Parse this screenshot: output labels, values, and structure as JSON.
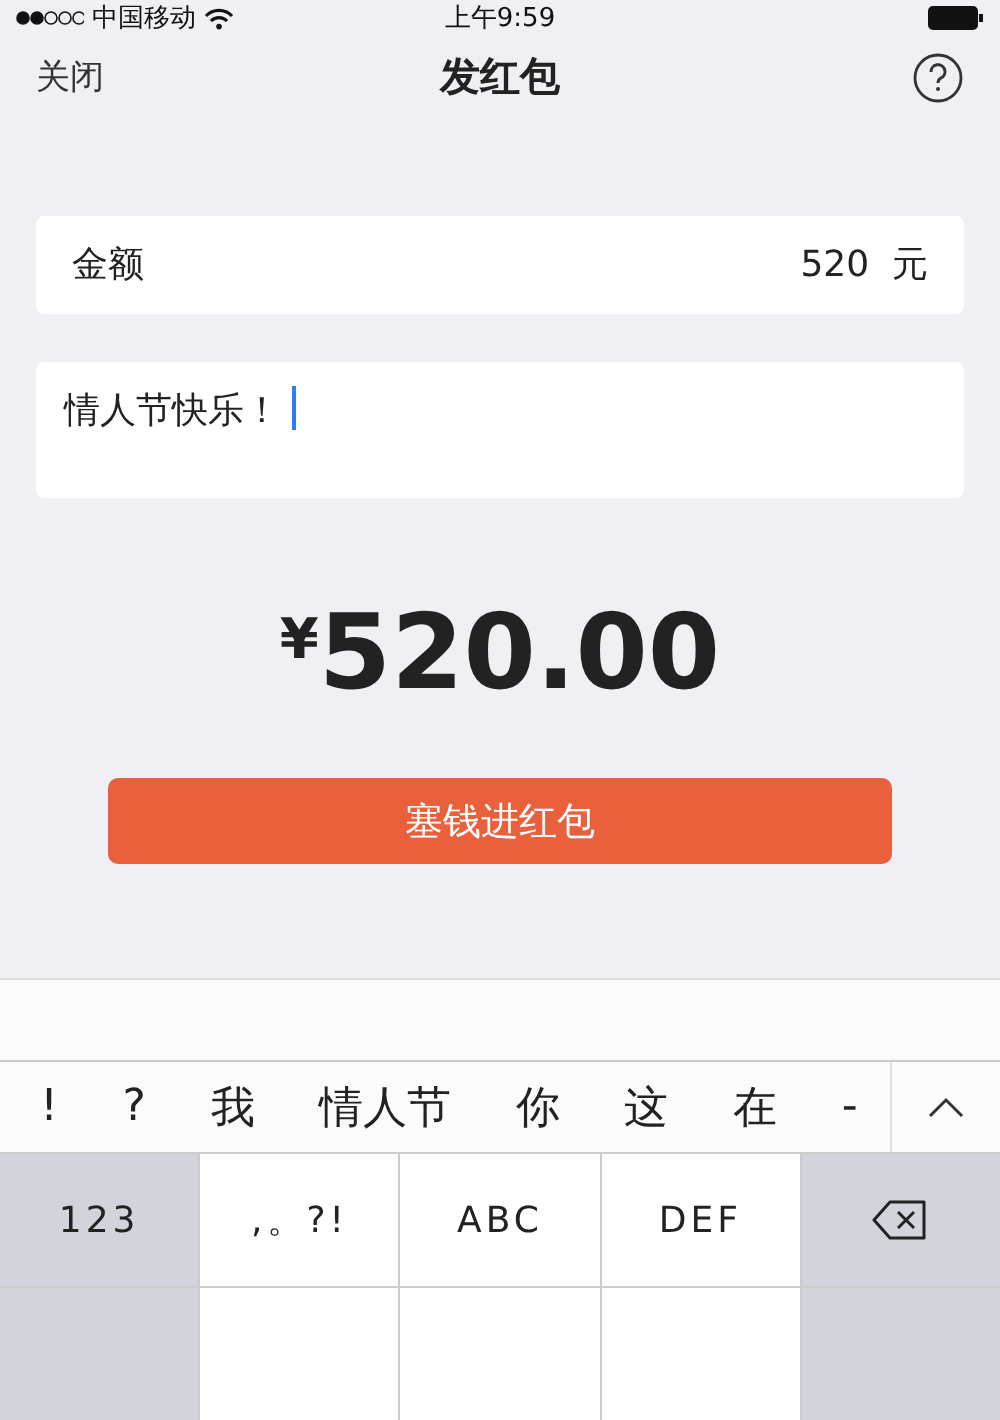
{
  "status_bar": {
    "carrier": "中国移动",
    "time": "上午9:59"
  },
  "nav": {
    "close": "关闭",
    "title": "发红包"
  },
  "amount_field": {
    "label": "金额",
    "value": "520",
    "unit": "元"
  },
  "message_field": {
    "value": "情人节快乐！"
  },
  "total": {
    "currency": "¥",
    "amount": "520.00"
  },
  "submit_button": "塞钱进红包",
  "candidates": [
    "!",
    "?",
    "我",
    "情人节",
    "你",
    "这",
    "在",
    "-"
  ],
  "keys": [
    {
      "label": "123",
      "kind": "function"
    },
    {
      "label": ",。?!",
      "kind": "letter"
    },
    {
      "label": "ABC",
      "kind": "letter"
    },
    {
      "label": "DEF",
      "kind": "letter"
    },
    {
      "kind": "backspace"
    }
  ]
}
